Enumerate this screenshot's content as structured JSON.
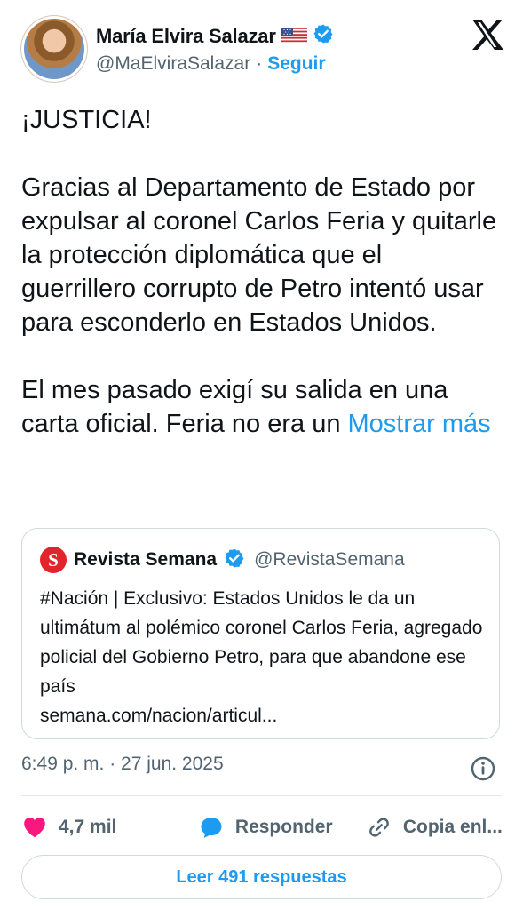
{
  "author": {
    "name": "María Elvira Salazar",
    "handle": "@MaElviraSalazar",
    "separator": "·",
    "follow_label": "Seguir",
    "flag_icon": "us-flag-icon",
    "verified_icon": "verified-badge-icon"
  },
  "tweet": {
    "text": "¡JUSTICIA!\n\nGracias al Departamento de Estado por expulsar al coronel Carlos Feria y quitarle la protección diplomática que el guerrillero corrupto de Petro intentó usar para esconderlo en Estados Unidos.\n\nEl mes pasado exigí su salida en una carta oficial. Feria no era un ",
    "show_more_label": "Mostrar más"
  },
  "quote": {
    "logo_letter": "S",
    "name": "Revista Semana",
    "handle": "@RevistaSemana",
    "text": "#Nación | Exclusivo: Estados Unidos le da un ultimátum al polémico coronel Carlos Feria, agregado policial del Gobierno Petro, para que abandone ese país\nsemana.com/nacion/articul..."
  },
  "meta": {
    "timestamp": "6:49 p. m. · 27 jun. 2025"
  },
  "actions": {
    "like_count": "4,7 mil",
    "reply_label": "Responder",
    "copy_label": "Copia enl..."
  },
  "read_replies_label": "Leer 491 respuestas",
  "colors": {
    "accent": "#1d9bf0",
    "heart": "#f91880",
    "text": "#0f1419",
    "muted": "#536471"
  }
}
